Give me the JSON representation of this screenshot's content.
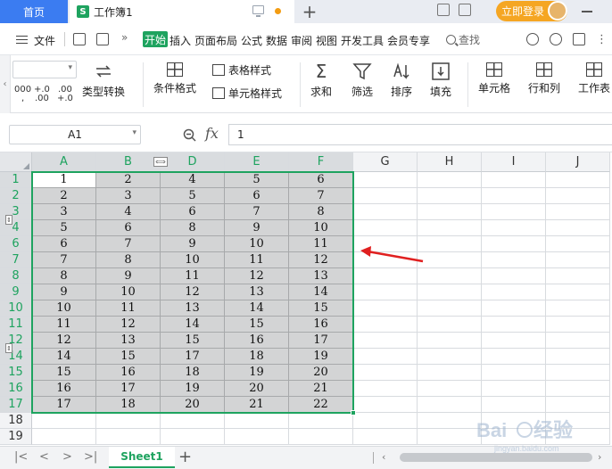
{
  "tabbar": {
    "home_label": "首页",
    "doc_icon": "S",
    "doc_title": "工作簿1",
    "login_label": "立即登录"
  },
  "menubar": {
    "file_label": "文件",
    "more_label": "»",
    "active_tab": "开始",
    "items": [
      "插入",
      "页面布局",
      "公式",
      "数据",
      "审阅",
      "视图",
      "开发工具",
      "会员专享"
    ],
    "search_label": "查找"
  },
  "ribbon": {
    "num_formats": [
      "000\n,",
      "+.0\n.00",
      ".00\n+.0"
    ],
    "type_convert": "类型转换",
    "cond_format": "条件格式",
    "table_style": "表格样式",
    "cell_style": "单元格样式",
    "sum": "求和",
    "filter": "筛选",
    "sort": "排序",
    "fill": "填充",
    "cell": "单元格",
    "row_col": "行和列",
    "worksheet": "工作表"
  },
  "formula_bar": {
    "name_box": "A1",
    "fx_label": "fx",
    "value": "1"
  },
  "grid": {
    "columns": [
      "A",
      "B",
      "D",
      "E",
      "F",
      "G",
      "H",
      "I",
      "J"
    ],
    "rows": [
      "1",
      "2",
      "3",
      "4",
      "6",
      "7",
      "8",
      "9",
      "10",
      "11",
      "12",
      "14",
      "15",
      "16",
      "17",
      "18",
      "19"
    ],
    "data": [
      [
        1,
        2,
        4,
        5,
        6
      ],
      [
        2,
        3,
        5,
        6,
        7
      ],
      [
        3,
        4,
        6,
        7,
        8
      ],
      [
        5,
        6,
        8,
        9,
        10
      ],
      [
        6,
        7,
        9,
        10,
        11
      ],
      [
        7,
        8,
        10,
        11,
        12
      ],
      [
        8,
        9,
        11,
        12,
        13
      ],
      [
        9,
        10,
        12,
        13,
        14
      ],
      [
        10,
        11,
        13,
        14,
        15
      ],
      [
        11,
        12,
        14,
        15,
        16
      ],
      [
        12,
        13,
        15,
        16,
        17
      ],
      [
        14,
        15,
        17,
        18,
        19
      ],
      [
        15,
        16,
        18,
        19,
        20
      ],
      [
        16,
        17,
        19,
        20,
        21
      ],
      [
        17,
        18,
        20,
        21,
        22
      ]
    ],
    "selection": "A1:F17",
    "accent": "#1ea35f",
    "arrow_color": "#e02020"
  },
  "sheetbar": {
    "sheet_name": "Sheet1",
    "add_label": "+"
  },
  "watermark": {
    "text": "Baidu 经验",
    "sub": "jingyan.baidu.com"
  }
}
